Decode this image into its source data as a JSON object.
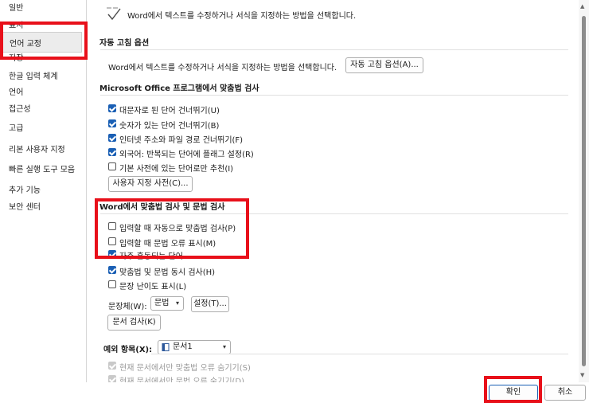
{
  "sidebar": {
    "items": [
      "일반",
      "표시",
      "언어 교정",
      "저장",
      "한글 입력 체계",
      "언어",
      "접근성",
      "고급",
      "리본 사용자 지정",
      "빠른 실행 도구 모음",
      "추가 기능",
      "보안 센터"
    ],
    "selected": "언어 교정"
  },
  "intro": {
    "text": "Word에서 텍스트를 수정하거나 서식을 지정하는 방법을 선택합니다."
  },
  "autocorrect": {
    "header": "자동 고침 옵션",
    "text": "Word에서 텍스트를 수정하거나 서식을 지정하는 방법을 선택합니다.",
    "button": "자동 고침 옵션(A)..."
  },
  "office_spell": {
    "header": "Microsoft Office 프로그램에서 맞춤법 검사",
    "options": [
      {
        "label": "대문자로 된 단어 건너뛰기(U)",
        "checked": true
      },
      {
        "label": "숫자가 있는 단어 건너뛰기(B)",
        "checked": true
      },
      {
        "label": "인터넷 주소와 파일 경로 건너뛰기(F)",
        "checked": true
      },
      {
        "label": "외국어: 반복되는 단어에 플래그 설정(R)",
        "checked": true
      },
      {
        "label": "기본 사전에 있는 단어로만 추천(I)",
        "checked": false
      }
    ],
    "custom_dict_button": "사용자 지정 사전(C)..."
  },
  "word_spell": {
    "header": "Word에서 맞춤법 검사 및 문법 검사",
    "options": [
      {
        "label": "입력할 때 자동으로 맞춤법 검사(P)",
        "checked": false
      },
      {
        "label": "입력할 때 문법 오류 표시(M)",
        "checked": false
      },
      {
        "label": "자주 혼동되는 단어",
        "checked": true
      },
      {
        "label": "맞춤법 및 문법 동시 검사(H)",
        "checked": true
      },
      {
        "label": "문장 난이도 표시(L)",
        "checked": false
      }
    ],
    "style_label": "문장체(W):",
    "style_value": "문법",
    "settings_button": "설정(T)...",
    "recheck_button": "문서 검사(K)"
  },
  "exceptions": {
    "label": "예외 항목(X):",
    "doc_value": "문서1",
    "options": [
      {
        "label": "현재 문서에서만 맞춤법 오류 숨기기(S)",
        "checked": true
      },
      {
        "label": "현재 문서에서만 문법 오류 숨기기(D)",
        "checked": true
      }
    ]
  },
  "footer": {
    "ok": "확인",
    "cancel": "취소"
  },
  "colors": {
    "highlight": "#e8101a",
    "accent": "#1a5fb4"
  },
  "icons": {
    "intro": "abc-check-icon",
    "document": "document-icon"
  }
}
